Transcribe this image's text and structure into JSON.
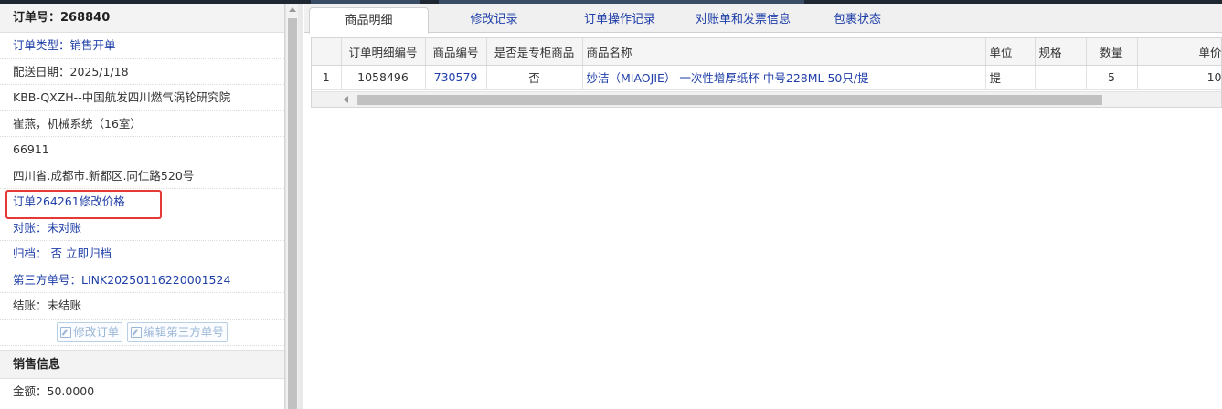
{
  "left": {
    "header": "订单号：268840",
    "order_type": "订单类型：销售开单",
    "delivery_date": "配送日期：2025/1/18",
    "customer": "KBB-QXZH--中国航发四川燃气涡轮研究院",
    "contact": "崔燕，机械系统（16室）",
    "phone": "66911",
    "address": "四川省.成都市.新都区.同仁路520号",
    "remark": "订单264261修改价格",
    "reconcile_label": "对账：",
    "reconcile_value": "未对账",
    "archive_label": "归档：",
    "archive_value": "否",
    "archive_action": "立即归档",
    "third_party_label": "第三方单号：",
    "third_party_value": "LINK20250116220001524",
    "settle": "结账：未结账",
    "btn_edit_order": "修改订单",
    "btn_edit_third": "编辑第三方单号",
    "sales_header": "销售信息",
    "amount": "金额：50.0000"
  },
  "tabs": [
    {
      "label": "商品明细",
      "active": true
    },
    {
      "label": "修改记录",
      "active": false
    },
    {
      "label": "订单操作记录",
      "active": false
    },
    {
      "label": "对账单和发票信息",
      "active": false
    },
    {
      "label": "包裹状态",
      "active": false
    }
  ],
  "table": {
    "headers": [
      "",
      "订单明细编号",
      "商品编号",
      "是否是专柜商品",
      "商品名称",
      "单位",
      "规格",
      "数量",
      "单价"
    ],
    "rows": [
      [
        "1",
        "1058496",
        "730579",
        "否",
        "妙洁（MIAOJIE） 一次性增厚纸杯 中号228ML 50只/提",
        "提",
        "",
        "5",
        "10"
      ]
    ]
  },
  "colors": {
    "link": "#1f3fa8",
    "highlight_border": "#e53935"
  }
}
